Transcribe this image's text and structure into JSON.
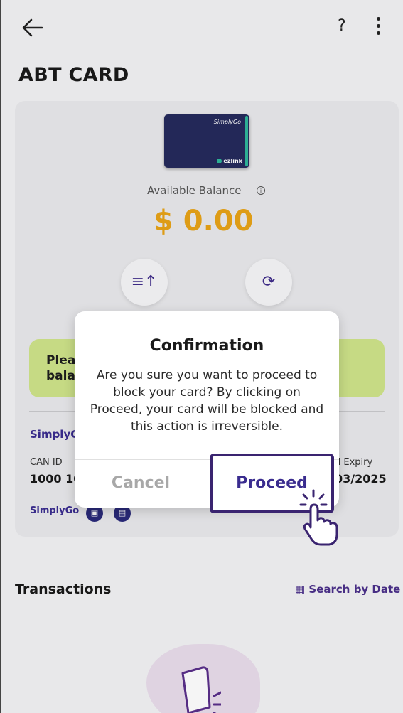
{
  "header": {
    "help_label": "?",
    "title": "ABT CARD"
  },
  "card": {
    "brand": "SimplyGo",
    "ez": "ezlink",
    "available_label": "Available Balance",
    "info_glyph": "i",
    "balance": "$ 0.00"
  },
  "actions": [
    {
      "icon": "top-up-icon",
      "glyph": "≡↑"
    },
    {
      "icon": "refresh-icon",
      "glyph": "⟳"
    }
  ],
  "notice": {
    "line1": "Plea",
    "line2": "bala"
  },
  "details": {
    "account_label": "SimplyG",
    "can_label": "CAN ID",
    "can_value": "1000 10",
    "expiry_label": "d Expiry",
    "expiry_value": "03/2025",
    "logo": "SimplyGo"
  },
  "transactions": {
    "title": "Transactions",
    "search_label": "Search by Date"
  },
  "modal": {
    "title": "Confirmation",
    "body": "Are you sure you want to proceed to block your card? By clicking on Proceed, your card will be blocked and this action is irreversible.",
    "cancel": "Cancel",
    "proceed": "Proceed"
  },
  "colors": {
    "accent": "#3a2c8f",
    "balance": "#e8a317",
    "notice_bg": "#cfe38a"
  }
}
